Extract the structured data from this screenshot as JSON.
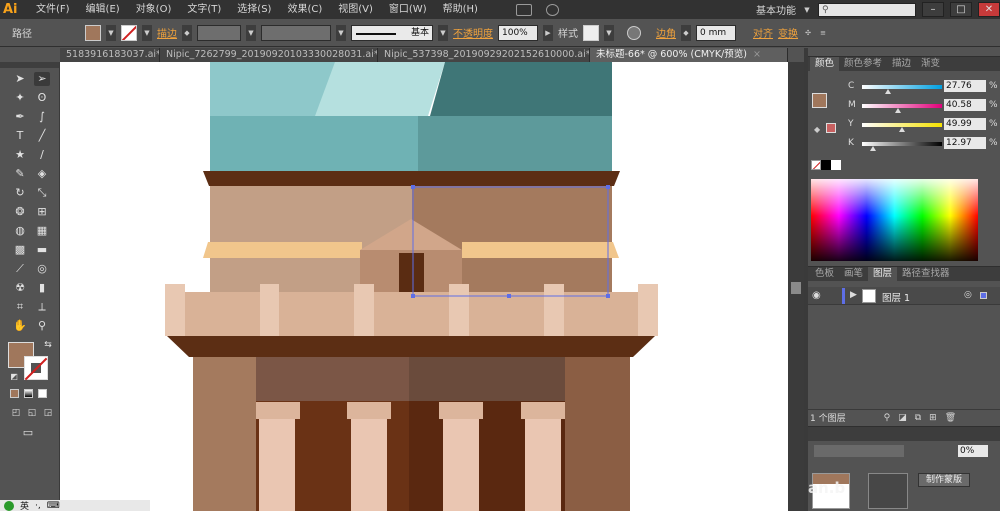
{
  "menubar": {
    "logo": "Ai",
    "items": [
      "文件(F)",
      "编辑(E)",
      "对象(O)",
      "文字(T)",
      "选择(S)",
      "效果(C)",
      "视图(V)",
      "窗口(W)",
      "帮助(H)"
    ],
    "workspace": "基本功能",
    "window_controls": [
      "–",
      "□",
      "✕"
    ]
  },
  "controlbar": {
    "selection_type": "路径",
    "fill_color": "#a0775c",
    "stroke_label": "描边",
    "stroke_style": "基本",
    "opacity_label": "不透明度",
    "opacity_value": "100%",
    "style_label": "样式",
    "corner_label": "边角",
    "corner_value": "0 mm",
    "align_label": "对齐",
    "transform_label": "变换"
  },
  "tabs": [
    {
      "label": "5183916183037.ai*",
      "active": false
    },
    {
      "label": "Nipic_7262799_20190920103330028031.ai*",
      "active": false
    },
    {
      "label": "Nipic_537398_20190929202152610000.ai*",
      "active": false
    },
    {
      "label": "未标题-66* @ 600% (CMYK/预览)",
      "active": true
    }
  ],
  "tools": {
    "fill_color": "#a0775c",
    "stroke_color": "#ffffff",
    "icons": [
      "selection-icon",
      "direct-selection-icon",
      "magic-wand-icon",
      "lasso-icon",
      "pen-icon",
      "curvature-icon",
      "type-icon",
      "line-icon",
      "rectangle-icon",
      "brush-icon",
      "pencil-icon",
      "eraser-icon",
      "rotate-icon",
      "scale-icon",
      "warp-icon",
      "free-transform-icon",
      "shape-builder-icon",
      "perspective-icon",
      "mesh-icon",
      "gradient-icon",
      "eyedropper-icon",
      "blend-icon",
      "symbol-sprayer-icon",
      "graph-icon",
      "artboard-icon",
      "slice-icon",
      "hand-icon",
      "zoom-icon"
    ]
  },
  "color_panel": {
    "tabs": [
      "颜色",
      "颜色参考",
      "描边",
      "渐变"
    ],
    "channels": [
      {
        "label": "C",
        "value": "27.76",
        "position": 0.28,
        "from": "#ffffff",
        "to": "#00a0e0"
      },
      {
        "label": "M",
        "value": "40.58",
        "position": 0.41,
        "from": "#ffffff",
        "to": "#e0007a"
      },
      {
        "label": "Y",
        "value": "49.99",
        "position": 0.5,
        "from": "#ffffff",
        "to": "#f5e100"
      },
      {
        "label": "K",
        "value": "12.97",
        "position": 0.13,
        "from": "#ffffff",
        "to": "#000000"
      }
    ],
    "percent_sign": "%"
  },
  "layers_panel": {
    "tabs": [
      "色板",
      "画笔",
      "图层",
      "路径查找器"
    ],
    "active_tab": "图层",
    "layer_name": "图层 1",
    "layer_count": "1 个图层"
  },
  "bottom_panel": {
    "opacity_value": "0%",
    "button_label": "制作蒙版",
    "watermark": "an.b"
  },
  "taskbar": {
    "ime": "英"
  }
}
